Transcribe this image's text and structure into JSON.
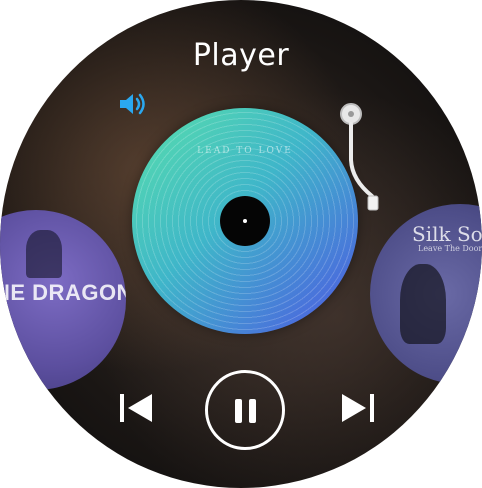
{
  "header": {
    "title": "Player"
  },
  "icons": {
    "volume": "volume-icon",
    "prev": "skip-previous-icon",
    "pause": "pause-icon",
    "next": "skip-next-icon",
    "tonearm": "tonearm-icon"
  },
  "now_playing": {
    "record_text": "LEAD TO LOVE"
  },
  "albums": {
    "previous": {
      "title": "NE DRAGONS",
      "subtitle": ""
    },
    "next": {
      "title": "Silk Son",
      "subtitle": "Leave The Door"
    }
  },
  "colors": {
    "accent": "#2aa8f0",
    "record_start": "#59e0ab",
    "record_end": "#4e5bd4",
    "control": "#ffffff"
  }
}
